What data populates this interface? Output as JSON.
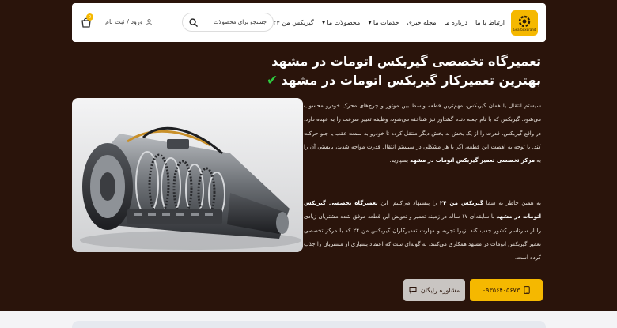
{
  "header": {
    "logo_text": "GearboxBrand",
    "nav": [
      {
        "label": "گیربکس من ۲۴",
        "caret": false
      },
      {
        "label": "محصولات ما",
        "caret": true
      },
      {
        "label": "خدمات ما",
        "caret": true
      },
      {
        "label": "مجله خبری",
        "caret": false
      },
      {
        "label": "درباره ما",
        "caret": false
      },
      {
        "label": "ارتباط با ما",
        "caret": false
      }
    ],
    "search_placeholder": "جستجو برای محصولات",
    "login_label": "ورود / ثبت نام",
    "cart_count": "0"
  },
  "hero": {
    "title_line1": "تعمیرگاه تخصصی گیربکس اتومات در مشهد",
    "title_line2": "بهترین تعمیرکار گیربکس اتومات در مشهد",
    "p1_a": "سیستم انتقال یا همان گیربکس، مهم‌ترین قطعه واسط بین موتور و چرخ‌های محرک خودرو محسوب می‌شود. گیربکس که با نام جعبه دنده گشتاور نیز شناخته می‌شود، وظیفه تغییر سرعت را به عهده دارد. در واقع گیربکس، قدرت را از یک بخش به بخش دیگر منتقل کرده تا خودرو به سمت عقب یا جلو حرکت کند. با توجه به اهمیت این قطعه، اگر با هر مشکلی در سیستم انتقال قدرت مواجه شدید، بایستی آن را به ",
    "p1_b": "مرکز تخصصی تعمیر گیربکس اتومات در مشهد",
    "p1_c": " بسپارید.",
    "p2_a": "به همین خاطر به شما ",
    "p2_b": "گیربکس من ۲۴",
    "p2_c": " را پیشنهاد می‌کنیم. این ",
    "p2_d": "تعمیرگاه تخصصی گیربکس اتومات در مشهد",
    "p2_e": " با سابقه‌ای ۱۷ ساله در زمینه تعمیر و تعویض این قطعه موفق شده مشتریان زیادی را از سرتاسر کشور جذب کند. زیرا تجربه و مهارت تعمیرکاران گیربکس من ۲۴ که با مرکز تخصصی تعمیر گیربکس اتومات در مشهد همکاری می‌کنند، به گونه‌ای ست که اعتماد بسیاری از مشتریان را جذب کرده است.",
    "phone_label": "۰۹۳۵۶۴۰۵۶۷۳",
    "consult_label": "مشاوره رایگان"
  },
  "colors": {
    "background": "#2a140b",
    "accent": "#f5b800",
    "check": "#2ecc40",
    "consult_button": "#c9c5c2"
  },
  "icons": [
    "gear-logo-icon",
    "search-icon",
    "user-icon",
    "cart-icon",
    "check-icon",
    "phone-icon",
    "chat-icon"
  ]
}
